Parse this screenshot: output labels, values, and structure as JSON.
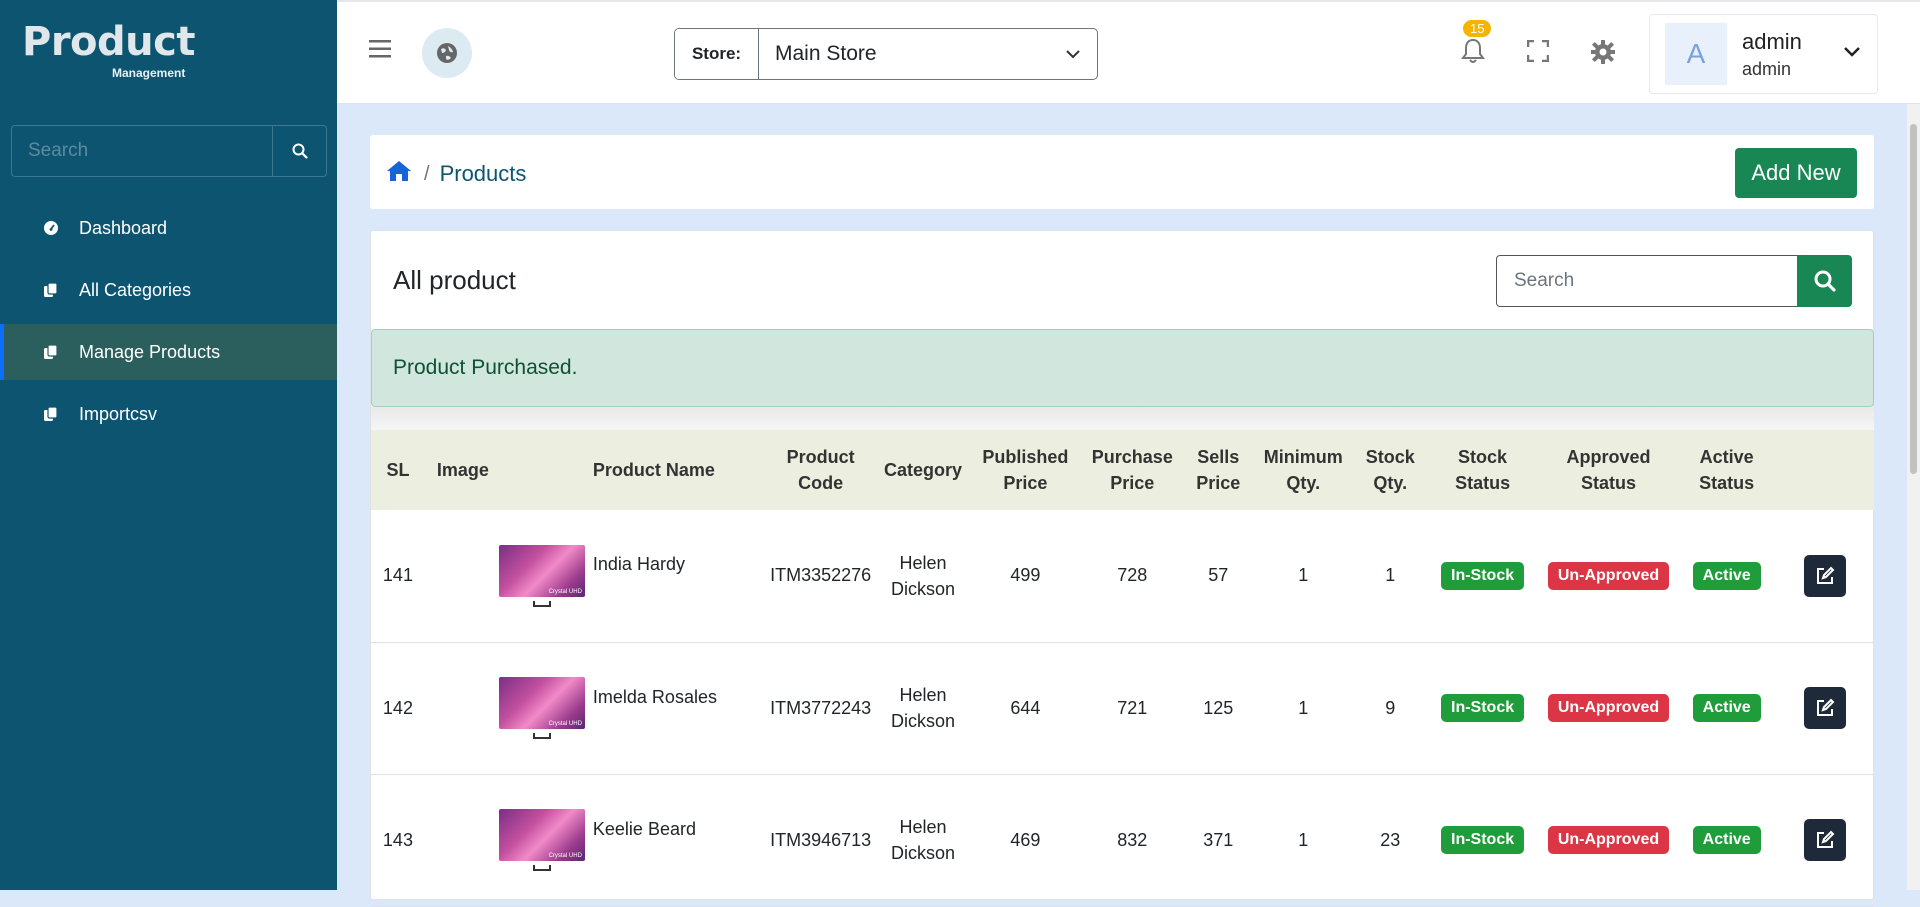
{
  "app": {
    "logo_main": "Product",
    "logo_sub": "Management"
  },
  "sidebar": {
    "search_placeholder": "Search",
    "items": [
      {
        "label": "Dashboard",
        "icon": "dashboard-icon",
        "active": false
      },
      {
        "label": "All Categories",
        "icon": "copy-icon",
        "active": false
      },
      {
        "label": "Manage Products",
        "icon": "copy-icon",
        "active": true
      },
      {
        "label": "Importcsv",
        "icon": "copy-icon",
        "active": false
      }
    ]
  },
  "header": {
    "store_label": "Store:",
    "store_value": "Main Store",
    "notification_count": "15",
    "user": {
      "avatar_letter": "A",
      "name": "admin",
      "role": "admin"
    }
  },
  "breadcrumb": {
    "page": "Products",
    "add_button": "Add New"
  },
  "main": {
    "title": "All product",
    "search_placeholder": "Search",
    "alert": "Product Purchased."
  },
  "table": {
    "headers": [
      "SL",
      "Image",
      "Product Name",
      "Product Code",
      "Category",
      "Published Price",
      "Purchase Price",
      "Sells Price",
      "Minimum Qty.",
      "Stock Qty.",
      "Stock Status",
      "Approved Status",
      "Active Status"
    ],
    "rows": [
      {
        "sl": "141",
        "name": "India Hardy",
        "code": "ITM3352276",
        "category": "Helen Dickson",
        "published": "499",
        "purchase": "728",
        "sells": "57",
        "min_qty": "1",
        "stock_qty": "1",
        "stock_status": "In-Stock",
        "approved_status": "Un-Approved",
        "active_status": "Active"
      },
      {
        "sl": "142",
        "name": "Imelda Rosales",
        "code": "ITM3772243",
        "category": "Helen Dickson",
        "published": "644",
        "purchase": "721",
        "sells": "125",
        "min_qty": "1",
        "stock_qty": "9",
        "stock_status": "In-Stock",
        "approved_status": "Un-Approved",
        "active_status": "Active"
      },
      {
        "sl": "143",
        "name": "Keelie Beard",
        "code": "ITM3946713",
        "category": "Helen Dickson",
        "published": "469",
        "purchase": "832",
        "sells": "371",
        "min_qty": "1",
        "stock_qty": "23",
        "stock_status": "In-Stock",
        "approved_status": "Un-Approved",
        "active_status": "Active"
      }
    ]
  },
  "colors": {
    "sidebar": "#0d5470",
    "primary_button": "#198754",
    "success_badge": "#1f9d3a",
    "danger_badge": "#dc3545"
  }
}
